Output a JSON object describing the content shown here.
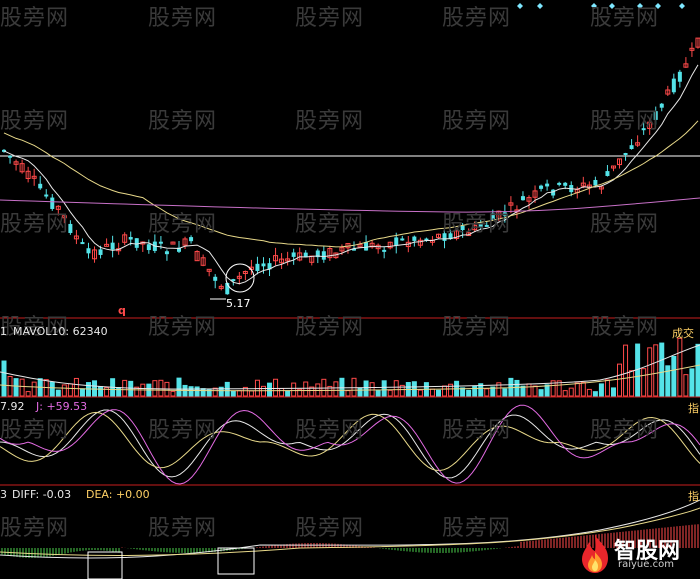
{
  "watermark": "股旁网",
  "price_panel": {
    "low_marker": "5.17",
    "stray_label": "q"
  },
  "volume_panel": {
    "label_prefix": "1",
    "mavol_label": "MAVOL10: 62340",
    "side_label": "成交"
  },
  "kdj_panel": {
    "label_prefix": "7.92",
    "j_label": "J: +59.53",
    "side_label": "指"
  },
  "macd_panel": {
    "label_prefix": "3",
    "diff_label": "DIFF: -0.03",
    "dea_label": "DEA: +0.00",
    "side_label": "指"
  },
  "logo": {
    "name": "智股网",
    "url": "raiyue.com"
  },
  "colors": {
    "up": "#ff4a4a",
    "down": "#54e3e8",
    "ma_white": "#e8e8e8",
    "ma_yellow": "#e8d98a",
    "ma_magenta": "#c770c7",
    "separator": "#c81e1e",
    "horizontal_line": "#ffffff",
    "circle": "#ffffff"
  },
  "chart_data": [
    {
      "type": "candlestick",
      "panel": "price",
      "candles_up_down_pattern": "mixed",
      "annotations": [
        {
          "text": "5.17",
          "meaning": "low point"
        }
      ]
    },
    {
      "type": "bar",
      "panel": "volume",
      "series": [
        {
          "name": "MAVOL10",
          "last_value": 62340
        }
      ]
    },
    {
      "type": "line",
      "panel": "kdj",
      "series": [
        {
          "name": "J",
          "last_value": 59.53
        }
      ]
    },
    {
      "type": "bar",
      "panel": "macd",
      "series": [
        {
          "name": "DIFF",
          "last_value": -0.03
        },
        {
          "name": "DEA",
          "last_value": 0.0
        }
      ]
    }
  ]
}
